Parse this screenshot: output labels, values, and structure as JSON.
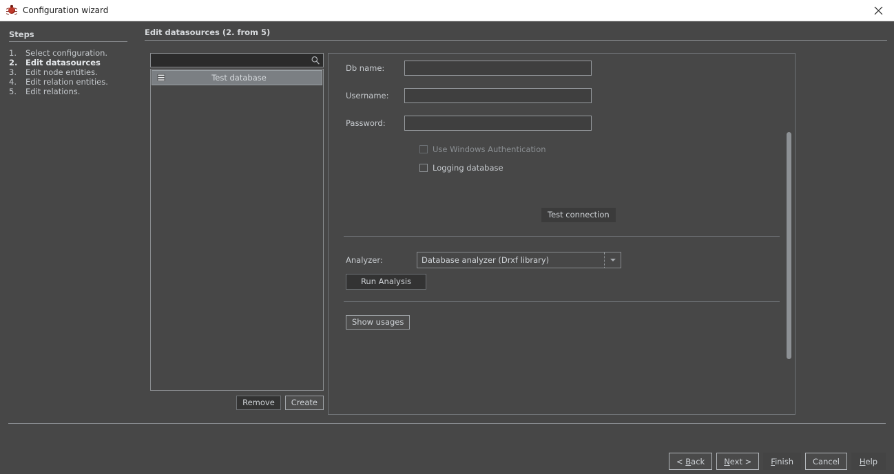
{
  "window": {
    "title": "Configuration wizard",
    "icon": "bug-icon",
    "close_label": "✕"
  },
  "steps": {
    "heading": "Steps",
    "items": [
      {
        "num": "1.",
        "label": "Select configuration.",
        "current": false
      },
      {
        "num": "2.",
        "label": "Edit datasources",
        "current": true
      },
      {
        "num": "3.",
        "label": "Edit node entities.",
        "current": false
      },
      {
        "num": "4.",
        "label": "Edit relation entities.",
        "current": false
      },
      {
        "num": "5.",
        "label": "Edit relations.",
        "current": false
      }
    ]
  },
  "content": {
    "title": "Edit datasources (2. from 5)"
  },
  "datasource_list": {
    "search": {
      "value": "",
      "placeholder": "",
      "icon": "search-icon"
    },
    "items": [
      {
        "label": "Test database",
        "icon": "database-icon",
        "selected": true
      }
    ],
    "remove_label": "Remove",
    "create_label": "Create"
  },
  "form": {
    "db_name": {
      "label": "Db name:",
      "value": "",
      "placeholder": ""
    },
    "username": {
      "label": "Username:",
      "value": "",
      "placeholder": ""
    },
    "password": {
      "label": "Password:",
      "value": "",
      "placeholder": ""
    },
    "use_windows_auth": {
      "label": "Use Windows Authentication",
      "checked": false,
      "disabled": true
    },
    "logging_database": {
      "label": "Logging database",
      "checked": false,
      "disabled": false
    },
    "test_connection_label": "Test connection",
    "analyzer": {
      "label": "Analyzer:",
      "selected": "Database analyzer (Drxf library)",
      "options": [
        "Database analyzer (Drxf library)"
      ]
    },
    "run_analysis_label": "Run Analysis",
    "show_usages_label": "Show usages"
  },
  "wizard_buttons": {
    "back": "< Back",
    "next": "Next >",
    "finish": "Finish",
    "cancel": "Cancel",
    "help": "Help"
  },
  "colors": {
    "background": "#474747",
    "titlebar": "#ffffff",
    "text": "#cfd3d7",
    "accent_rule": "#8d9094",
    "selection": "#7b7f83",
    "input_bg": "#3f3f3f"
  }
}
